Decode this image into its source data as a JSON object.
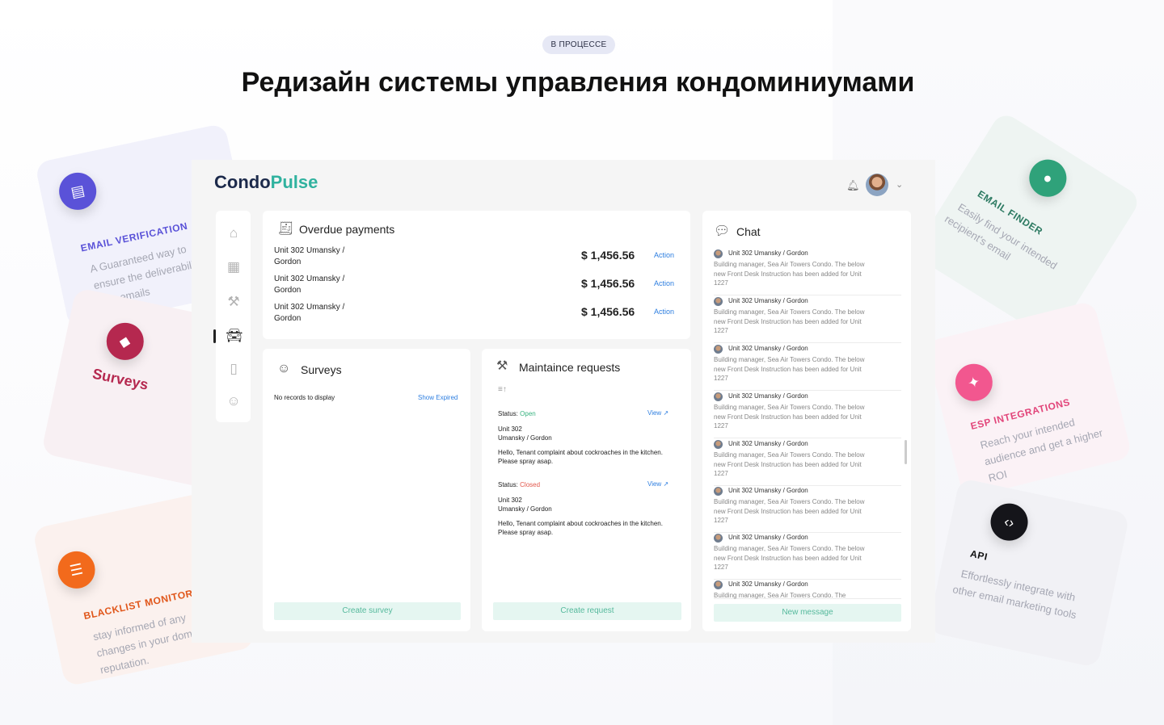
{
  "header": {
    "badge": "В ПРОЦЕССЕ",
    "title": "Редизайн системы управления кондоминиумами"
  },
  "feature_cards": {
    "email_verification": {
      "label": "EMAIL VERIFICATION",
      "desc": [
        "A Guaranteed way to",
        "ensure the deliverability",
        "your emails"
      ]
    },
    "surveys": {
      "label": "Surveys"
    },
    "blacklist": {
      "label": "BLACKLIST MONITORING",
      "desc": [
        "stay informed of any",
        "changes in your domain",
        "reputation."
      ]
    },
    "email_finder": {
      "label": "EMAIL FINDER",
      "desc": [
        "Easily find your intended",
        "recipient's email"
      ]
    },
    "esp": {
      "label": "ESP INTEGRATIONS",
      "desc": [
        "Reach your intended",
        "audience and get a higher",
        "ROI"
      ]
    },
    "api": {
      "label": "API",
      "desc": [
        "Effortlessly integrate with",
        "other email marketing tools"
      ]
    }
  },
  "app": {
    "logo_part1": "Condo",
    "logo_part2": "Pulse",
    "overdue": {
      "title": "Overdue payments",
      "rows": [
        {
          "unit": "Unit 302 Umansky / Gordon",
          "amount": "$ 1,456.56",
          "action": "Action"
        },
        {
          "unit": "Unit 302 Umansky / Gordon",
          "amount": "$ 1,456.56",
          "action": "Action"
        },
        {
          "unit": "Unit 302 Umansky / Gordon",
          "amount": "$ 1,456.56",
          "action": "Action"
        }
      ]
    },
    "surveys": {
      "title": "Surveys",
      "empty": "No records to display",
      "show_expired": "Show Expired",
      "create": "Create  survey"
    },
    "maintenance": {
      "title": "Maintaince requests",
      "status_label": "Status:",
      "items": [
        {
          "status": "Open",
          "view": "View",
          "unit1": "Unit 302",
          "unit2": "Umansky / Gordon",
          "text": "Hello, Tenant complaint about cockroaches in the kitchen. Please spray asap."
        },
        {
          "status": "Closed",
          "view": "View",
          "unit1": "Unit 302",
          "unit2": "Umansky / Gordon",
          "text": "Hello, Tenant complaint about cockroaches in the kitchen. Please spray asap."
        }
      ],
      "create": "Create request"
    },
    "chat": {
      "title": "Chat",
      "messages": [
        {
          "who": "Unit 302 Umansky / Gordon",
          "text": "Building manager, Sea Air Towers Condo. The below new Front Desk Instruction has been added for Unit 1227"
        },
        {
          "who": "Unit 302 Umansky / Gordon",
          "text": "Building manager, Sea Air Towers Condo. The below new Front Desk Instruction has been added for Unit 1227"
        },
        {
          "who": "Unit 302 Umansky / Gordon",
          "text": "Building manager, Sea Air Towers Condo. The below new Front Desk Instruction has been added for Unit 1227"
        },
        {
          "who": "Unit 302 Umansky / Gordon",
          "text": "Building manager, Sea Air Towers Condo. The below new Front Desk Instruction has been added for Unit 1227"
        },
        {
          "who": "Unit 302 Umansky / Gordon",
          "text": "Building manager, Sea Air Towers Condo. The below new Front Desk Instruction has been added for Unit 1227"
        },
        {
          "who": "Unit 302 Umansky / Gordon",
          "text": "Building manager, Sea Air Towers Condo. The below new Front Desk Instruction has been added for Unit 1227"
        },
        {
          "who": "Unit 302 Umansky / Gordon",
          "text": "Building manager, Sea Air Towers Condo. The below new Front Desk Instruction has been added for Unit 1227"
        },
        {
          "who": "Unit 302 Umansky / Gordon",
          "text": "Building manager, Sea Air Towers Condo. The"
        }
      ],
      "new_message": "New message"
    }
  }
}
